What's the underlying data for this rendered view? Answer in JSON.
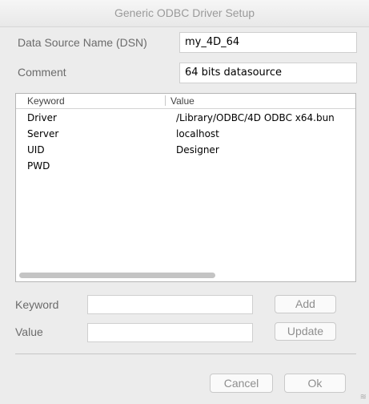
{
  "window": {
    "title": "Generic ODBC Driver Setup"
  },
  "dsn": {
    "label": "Data Source Name (DSN)",
    "value": "my_4D_64"
  },
  "comment": {
    "label": "Comment",
    "value": "64 bits datasource"
  },
  "table": {
    "headers": {
      "keyword": "Keyword",
      "value": "Value"
    },
    "rows": [
      {
        "keyword": "Driver",
        "value": "/Library/ODBC/4D ODBC x64.bun"
      },
      {
        "keyword": "Server",
        "value": "localhost"
      },
      {
        "keyword": "UID",
        "value": "Designer"
      },
      {
        "keyword": "PWD",
        "value": ""
      }
    ]
  },
  "editor": {
    "keyword_label": "Keyword",
    "value_label": "Value",
    "add_label": "Add",
    "update_label": "Update"
  },
  "footer": {
    "cancel_label": "Cancel",
    "ok_label": "Ok"
  }
}
